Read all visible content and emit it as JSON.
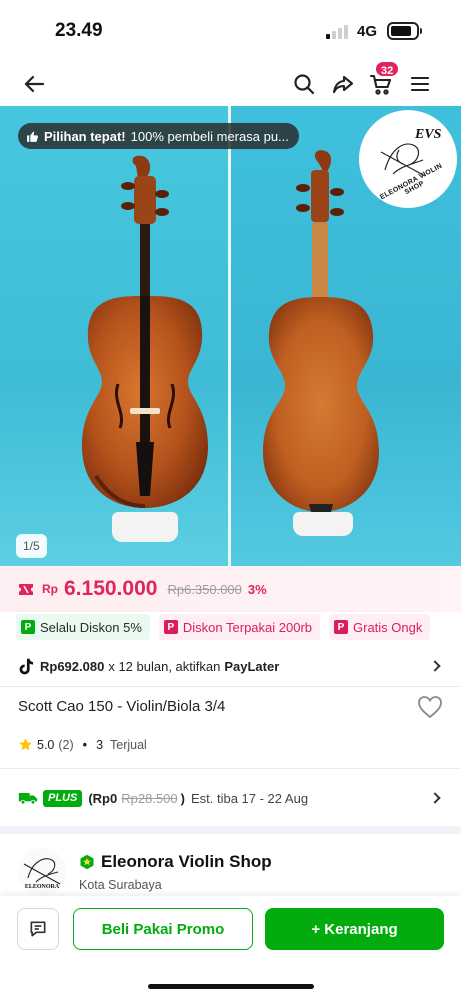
{
  "status_bar": {
    "time": "23.49",
    "network": "4G"
  },
  "nav": {
    "cart_count": "32"
  },
  "gallery": {
    "promo_bold": "Pilihan tepat!",
    "promo_rest": "100% pembeli merasa pu...",
    "logo_text": "EVS",
    "logo_subtitle": "ELEONORA VIOLIN SHOP",
    "counter": "1/5"
  },
  "price": {
    "currency": "Rp",
    "current": "6.150.000",
    "original": "Rp6.350.000",
    "discount": "3%"
  },
  "chips": [
    {
      "label": "Selalu Diskon 5%",
      "style": "green"
    },
    {
      "label": "Diskon Terpakai 200rb",
      "style": "pink"
    },
    {
      "label": "Gratis Ongk",
      "style": "pink"
    }
  ],
  "paylater": {
    "amount": "Rp692.080",
    "middle": "x 12 bulan, aktifkan",
    "provider": "PayLater"
  },
  "product": {
    "title": "Scott Cao 150 - Violin/Biola 3/4",
    "rating": "5.0",
    "reviews": "(2)",
    "sold_count": "3",
    "sold_label": "Terjual"
  },
  "shipping": {
    "badge": "PLUS",
    "price": "(Rp0",
    "original": "Rp28.500",
    "close": ")",
    "estimate": "Est. tiba 17 - 22 Aug"
  },
  "shop": {
    "name": "Eleonora Violin Shop",
    "city": "Kota Surabaya",
    "avatar_text": "ELEONORA"
  },
  "actions": {
    "promo_button": "Beli Pakai Promo",
    "cart_button": "+ Keranjang"
  },
  "colors": {
    "brand_green": "#03ac0e",
    "price_red": "#e0245e",
    "gallery_bg": "#45c3dc"
  }
}
